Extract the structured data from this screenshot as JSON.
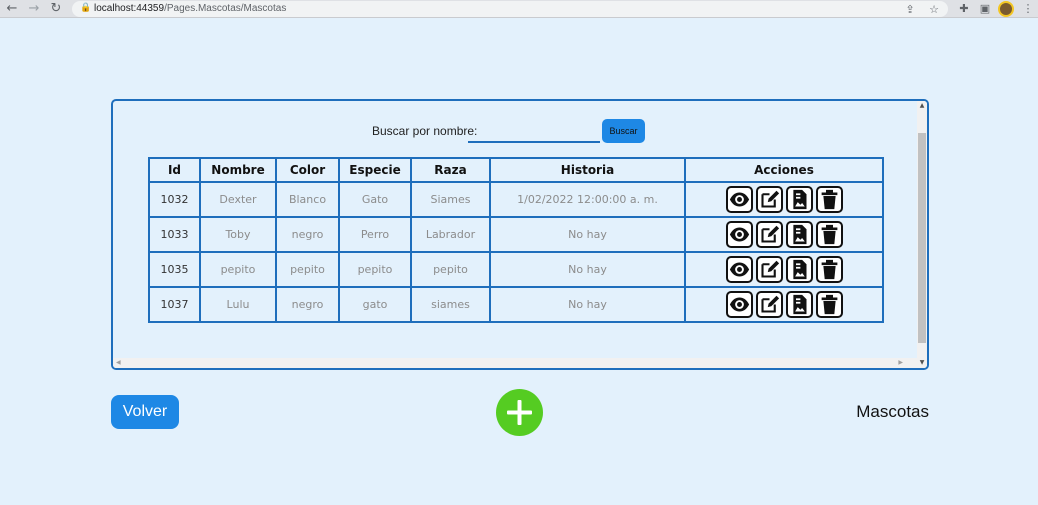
{
  "browser": {
    "url_host": "localhost:44359",
    "url_path": "/Pages.Mascotas/Mascotas",
    "icons": [
      "back-arrow-icon",
      "forward-arrow-icon",
      "reload-icon",
      "lock-icon",
      "share-icon",
      "star-icon",
      "puzzle-extension-icon",
      "side-panel-icon",
      "menu-dots-icon"
    ]
  },
  "search": {
    "label": "Buscar por nombre:",
    "value": "",
    "placeholder": "",
    "button_label": "Buscar"
  },
  "table": {
    "headers": [
      "Id",
      "Nombre",
      "Color",
      "Especie",
      "Raza",
      "Historia",
      "Acciones"
    ],
    "rows": [
      {
        "id": "1032",
        "nombre": "Dexter",
        "color": "Blanco",
        "especie": "Gato",
        "raza": "Siames",
        "historia": "1/02/2022 12:00:00 a. m."
      },
      {
        "id": "1033",
        "nombre": "Toby",
        "color": "negro",
        "especie": "Perro",
        "raza": "Labrador",
        "historia": "No hay"
      },
      {
        "id": "1035",
        "nombre": "pepito",
        "color": "pepito",
        "especie": "pepito",
        "raza": "pepito",
        "historia": "No hay"
      },
      {
        "id": "1037",
        "nombre": "Lulu",
        "color": "negro",
        "especie": "gato",
        "raza": "siames",
        "historia": "No hay"
      }
    ],
    "action_icons": [
      "eye-icon",
      "edit-icon",
      "document-icon",
      "trash-icon"
    ]
  },
  "footer": {
    "back_label": "Volver",
    "add_icon": "plus-icon",
    "page_title": "Mascotas"
  },
  "colors": {
    "background": "#e3f1fc",
    "border_blue": "#1e6ebc",
    "button_blue": "#1e88e5",
    "add_green": "#55cc22"
  }
}
